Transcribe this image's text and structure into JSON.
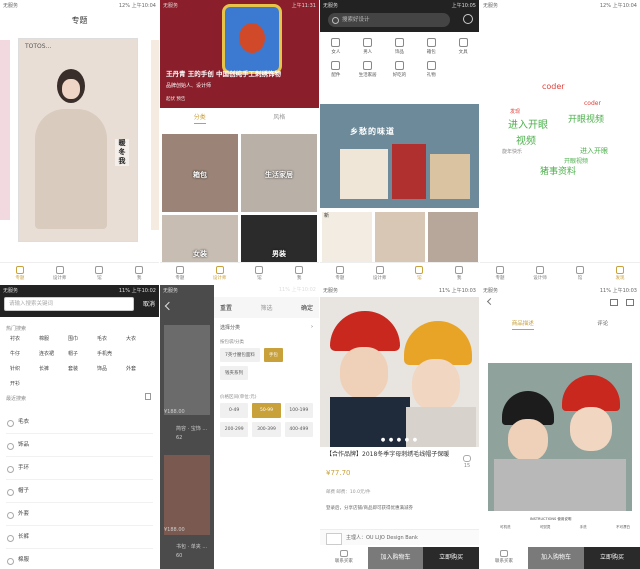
{
  "status": {
    "carrier": "无服务",
    "p1_right": "12%  上午10:04",
    "p2_right": "上午11:31",
    "p3_right": "上午10:05",
    "p4_right": "12%  上午10:04",
    "p5_right": "11%  上午10:02",
    "p6_right": "11%  上午10:02",
    "p7_right": "11%  上午10:03",
    "p8_right": "11%  上午10:03"
  },
  "tabbar": {
    "items": [
      "专题",
      "设计师",
      "馆",
      "我"
    ],
    "items_alt": [
      "专题",
      "设计师",
      "馆",
      "发现"
    ]
  },
  "p1": {
    "header": "专题",
    "logo": "TOTOS..."
  },
  "p2": {
    "hero_title": "王丹青 王的手创 中国创纯手工刺绣饰物",
    "hero_sub": "品牌创始人、设计师",
    "hero_by": "起伏  预告",
    "tabs": [
      "分类",
      "风格"
    ],
    "tiles": [
      "箱包",
      "生活家居",
      "女装",
      "男装"
    ]
  },
  "p3": {
    "search_placeholder": "搜索好设计",
    "categories": [
      "女人",
      "男人",
      "饰品",
      "箱包",
      "文具",
      "配件",
      "生活家居",
      "好吃的",
      "礼物"
    ],
    "banner_text": "乡愁的味道",
    "thumbs": [
      "新",
      "",
      ""
    ]
  },
  "p4": {
    "words": [
      {
        "text": "coder",
        "color": "#e0403a",
        "size": 8
      },
      {
        "text": "进入开眼",
        "color": "#4cb04c",
        "size": 10
      },
      {
        "text": "开眼视频",
        "color": "#4cb04c",
        "size": 9
      },
      {
        "text": "视频",
        "color": "#4cb04c",
        "size": 10
      },
      {
        "text": "进入开眼",
        "color": "#4cb04c",
        "size": 7
      },
      {
        "text": "猪事资料",
        "color": "#4cb04c",
        "size": 9
      },
      {
        "text": "coder",
        "color": "#e0403a",
        "size": 6
      },
      {
        "text": "旋年快乐",
        "color": "#888888",
        "size": 5
      },
      {
        "text": "发现",
        "color": "#e0403a",
        "size": 5
      },
      {
        "text": "开眼视频",
        "color": "#4cb04c",
        "size": 6
      }
    ]
  },
  "p5": {
    "search_placeholder": "请输入搜索关键词",
    "cancel": "取消",
    "hot_label": "热门搜索",
    "hot": [
      "衬衣",
      "棉服",
      "围巾",
      "毛衣",
      "大衣",
      "牛仔",
      "连衣裙",
      "帽子",
      "手机壳",
      "",
      "针织",
      "长裤",
      "套装",
      "饰品",
      "外套",
      "开衫"
    ],
    "history_label": "最近搜索",
    "history": [
      "毛衣",
      "饰品",
      "手环",
      "帽子",
      "外套",
      "长裤",
      "棉服"
    ]
  },
  "p6": {
    "bg_texts": [
      "¥188.00",
      "简容 · 宝饰 ...",
      "62",
      "¥188.00",
      "书包 · 单夹 ...",
      "60"
    ],
    "reset": "重置",
    "filter": "筛选",
    "confirm": "确定",
    "row_all": "选择分类",
    "sec_size": "按包袋/分类",
    "chips_size": [
      "7英寸腰包面料",
      "手包",
      "钱夹系列"
    ],
    "sec_price": "价格区间(单位:元)",
    "prices": [
      "0-49",
      "50-99",
      "100-199",
      "200-299",
      "300-399",
      "400-499"
    ]
  },
  "p7": {
    "dots": "● ● ● ● ●",
    "title": "【合作品牌】2018冬季字母刺绣毛线帽子保暖",
    "fav_count": "15",
    "price": "¥77.70",
    "ship": "邮费  邮费：10.0元/件",
    "note": "登录后，分享店铺/商品即可获得优惠满减券",
    "brand": "主理人：OU LIJO Design Bank"
  },
  "p8": {
    "tabs": [
      "商品描述",
      "评论"
    ],
    "instructions": "INSTRUCTIONS  使用说明",
    "instr_items": [
      "可机洗",
      "可熨烫",
      "手洗",
      "不可漂白"
    ]
  },
  "cta": {
    "service": "联系买家",
    "cart": "加入购物车",
    "buy": "立即购买"
  }
}
